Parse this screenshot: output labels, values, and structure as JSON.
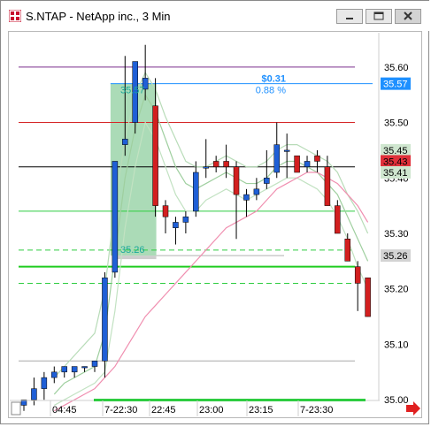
{
  "window": {
    "title": "S.NTAP - NetApp inc., 3 Min",
    "minimize_label": "minimize",
    "maximize_label": "maximize",
    "close_label": "close"
  },
  "chart_data": {
    "type": "candlestick",
    "symbol": "S.NTAP",
    "interval": "3 Min",
    "ylim": [
      34.97,
      35.63
    ],
    "y_ticks": [
      "35.60",
      "35.50",
      "35.40",
      "35.30",
      "35.20",
      "35.10",
      "35.00"
    ],
    "x_ticks": [
      "04:45",
      "7-22:30",
      "22:45",
      "23:00",
      "23:15",
      "7-23:30"
    ],
    "price_badges": [
      {
        "label": "35.57",
        "value": 35.57,
        "bg": "#1e90ff",
        "fg": "#ffffff"
      },
      {
        "label": "35.45",
        "value": 35.45,
        "bg": "#cfe6cf",
        "fg": "#000000"
      },
      {
        "label": "35.43",
        "value": 35.43,
        "bg": "#e0303a",
        "fg": "#000000"
      },
      {
        "label": "35.41",
        "value": 35.41,
        "bg": "#cfe6cf",
        "fg": "#000000"
      },
      {
        "label": "35.26",
        "value": 35.26,
        "bg": "#d3d3d3",
        "fg": "#000000"
      }
    ],
    "hlines": [
      {
        "value": 35.6,
        "color": "#7a2d8c",
        "dash": false
      },
      {
        "value": 35.5,
        "color": "#d62728",
        "dash": false
      },
      {
        "value": 35.42,
        "color": "#000000",
        "dash": false
      },
      {
        "value": 35.34,
        "color": "#2ecc40",
        "dash": false
      },
      {
        "value": 35.27,
        "color": "#2ecc40",
        "dash": true
      },
      {
        "value": 35.24,
        "color": "#1fcc1f",
        "dash": false,
        "thick": true
      },
      {
        "value": 35.21,
        "color": "#2ecc40",
        "dash": true
      },
      {
        "value": 35.07,
        "color": "#a9a9a9",
        "dash": false
      }
    ],
    "measure": {
      "from": 35.26,
      "to": 35.57,
      "from_label": "35.26",
      "to_label": "35.57",
      "change_label": "$0.31",
      "pct_label": "0.88 %"
    },
    "candles": [
      {
        "o": 34.99,
        "h": 35.0,
        "l": 34.98,
        "c": 35.0
      },
      {
        "o": 35.0,
        "h": 35.04,
        "l": 34.99,
        "c": 35.02
      },
      {
        "o": 35.02,
        "h": 35.05,
        "l": 35.0,
        "c": 35.04
      },
      {
        "o": 35.04,
        "h": 35.06,
        "l": 35.03,
        "c": 35.05
      },
      {
        "o": 35.05,
        "h": 35.06,
        "l": 35.04,
        "c": 35.06
      },
      {
        "o": 35.05,
        "h": 35.06,
        "l": 35.04,
        "c": 35.06
      },
      {
        "o": 35.06,
        "h": 35.06,
        "l": 35.05,
        "c": 35.06
      },
      {
        "o": 35.06,
        "h": 35.07,
        "l": 35.05,
        "c": 35.07
      },
      {
        "o": 35.07,
        "h": 35.23,
        "l": 35.04,
        "c": 35.22
      },
      {
        "o": 35.23,
        "h": 35.43,
        "l": 35.22,
        "c": 35.43
      },
      {
        "o": 35.46,
        "h": 35.62,
        "l": 35.44,
        "c": 35.47
      },
      {
        "o": 35.5,
        "h": 35.61,
        "l": 35.48,
        "c": 35.61
      },
      {
        "o": 35.56,
        "h": 35.64,
        "l": 35.54,
        "c": 35.58
      },
      {
        "o": 35.53,
        "h": 35.58,
        "l": 35.33,
        "c": 35.35
      },
      {
        "o": 35.35,
        "h": 35.36,
        "l": 35.3,
        "c": 35.33
      },
      {
        "o": 35.31,
        "h": 35.33,
        "l": 35.28,
        "c": 35.32
      },
      {
        "o": 35.32,
        "h": 35.34,
        "l": 35.3,
        "c": 35.33
      },
      {
        "o": 35.34,
        "h": 35.43,
        "l": 35.33,
        "c": 35.41
      },
      {
        "o": 35.42,
        "h": 35.47,
        "l": 35.4,
        "c": 35.42
      },
      {
        "o": 35.43,
        "h": 35.44,
        "l": 35.41,
        "c": 35.42
      },
      {
        "o": 35.43,
        "h": 35.46,
        "l": 35.4,
        "c": 35.42
      },
      {
        "o": 35.42,
        "h": 35.43,
        "l": 35.29,
        "c": 35.37
      },
      {
        "o": 35.36,
        "h": 35.38,
        "l": 35.33,
        "c": 35.37
      },
      {
        "o": 35.37,
        "h": 35.4,
        "l": 35.36,
        "c": 35.38
      },
      {
        "o": 35.39,
        "h": 35.45,
        "l": 35.38,
        "c": 35.4
      },
      {
        "o": 35.41,
        "h": 35.5,
        "l": 35.4,
        "c": 35.46
      },
      {
        "o": 35.45,
        "h": 35.48,
        "l": 35.4,
        "c": 35.45
      },
      {
        "o": 35.44,
        "h": 35.44,
        "l": 35.41,
        "c": 35.41
      },
      {
        "o": 35.42,
        "h": 35.44,
        "l": 35.41,
        "c": 35.43
      },
      {
        "o": 35.44,
        "h": 35.45,
        "l": 35.41,
        "c": 35.43
      },
      {
        "o": 35.42,
        "h": 35.44,
        "l": 35.35,
        "c": 35.35
      },
      {
        "o": 35.35,
        "h": 35.36,
        "l": 35.32,
        "c": 35.3
      },
      {
        "o": 35.29,
        "h": 35.3,
        "l": 35.25,
        "c": 35.25
      },
      {
        "o": 35.24,
        "h": 35.25,
        "l": 35.16,
        "c": 35.21
      },
      {
        "o": 35.22,
        "h": 35.22,
        "l": 35.15,
        "c": 35.15
      }
    ],
    "ma_upper": [
      null,
      null,
      null,
      35.04,
      35.06,
      35.08,
      35.1,
      35.12,
      35.2,
      35.35,
      35.47,
      35.55,
      35.59,
      35.56,
      35.51,
      35.47,
      35.43,
      35.42,
      35.42,
      35.43,
      35.44,
      35.43,
      35.42,
      35.42,
      35.43,
      35.45,
      35.46,
      35.46,
      35.45,
      35.44,
      35.43,
      35.41,
      35.37,
      35.34,
      35.3
    ],
    "ma_middle": [
      null,
      null,
      null,
      35.01,
      35.03,
      35.04,
      35.05,
      35.06,
      35.12,
      35.26,
      35.4,
      35.49,
      35.55,
      35.52,
      35.47,
      35.42,
      35.39,
      35.38,
      35.39,
      35.4,
      35.41,
      35.4,
      35.39,
      35.39,
      35.4,
      35.42,
      35.43,
      35.43,
      35.42,
      35.41,
      35.39,
      35.37,
      35.33,
      35.29,
      35.25
    ],
    "ma_lower": [
      null,
      null,
      null,
      34.99,
      35.0,
      35.01,
      35.02,
      35.03,
      35.05,
      35.16,
      35.31,
      35.42,
      35.5,
      35.47,
      35.42,
      35.37,
      35.34,
      35.34,
      35.36,
      35.37,
      35.38,
      35.37,
      35.36,
      35.37,
      35.38,
      35.39,
      35.4,
      35.4,
      35.39,
      35.38,
      35.36,
      35.33,
      35.29,
      35.24,
      35.2
    ],
    "ma_slow": [
      null,
      null,
      null,
      34.98,
      34.99,
      35.0,
      35.01,
      35.02,
      35.04,
      35.06,
      35.09,
      35.12,
      35.15,
      35.17,
      35.19,
      35.21,
      35.23,
      35.25,
      35.27,
      35.29,
      35.31,
      35.32,
      35.33,
      35.34,
      35.36,
      35.38,
      35.39,
      35.4,
      35.41,
      35.41,
      35.4,
      35.39,
      35.37,
      35.35,
      35.32
    ]
  }
}
